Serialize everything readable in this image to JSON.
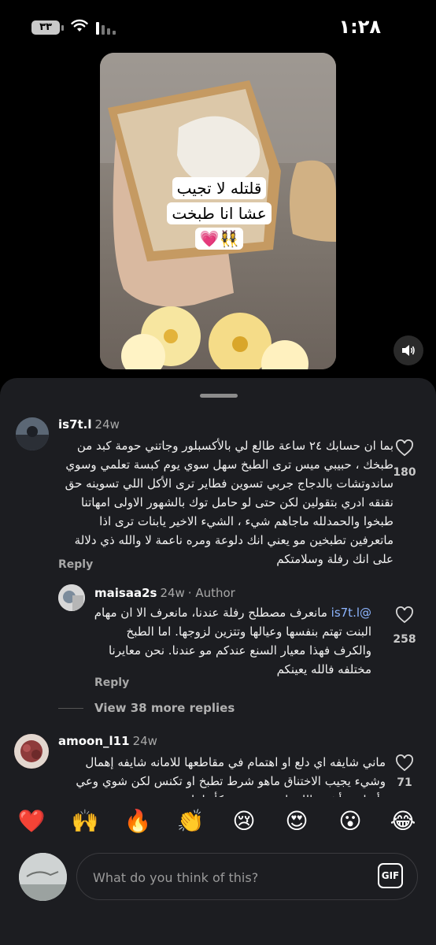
{
  "status_bar": {
    "time": "١:٢٨",
    "battery": "٣٣"
  },
  "video": {
    "caption": "قلتله لا تجيب عشا انا طبخت👯‍♀️💗"
  },
  "comments": [
    {
      "username": "is7t.l",
      "age": "24w",
      "text": "بما ان حسابك ٢٤ ساعة طالع لي بالأكسبلور وجاتني حومة كبد من طبخك ، حبيبي ميس ترى الطبخ سهل سوي يوم كبسة تعلمي وسوي ساندوتشات بالدجاج جربي تسوين فطاير ترى الأكل اللي تسوينه حق نقنقه ادري بتقولين لكن حتى لو حامل توك بالشهور الاولى امهاتنا طبخوا والحمدلله ماجاهم شيء ، الشيء الاخير يابنات ترى اذا ماتعرفين تطبخين مو يعني انك دلوعة ومره ناعمة لا والله ذي دلالة على انك رفلة وسلامتكم",
      "reply_label": "Reply",
      "likes": "180"
    },
    {
      "username": "maisaa2s",
      "age": "24w",
      "badge": "· Author",
      "mention": "@is7t.l",
      "text": "مانعرف مصطلح رفلة عندنا، مانعرف الا ان مهام البنت تهتم بنفسها وعيالها وتتزين لزوجها. اما الطبخ والكرف فهذا معيار السنع عندكم مو عندنا. نحن معايرنا مختلفه فالله يعينكم",
      "reply_label": "Reply",
      "likes": "258"
    },
    {
      "username": "amoon_l11",
      "age": "24w",
      "text": "ماني شايفه اي دلع او اهتمام في مقاطعها للامانه شايفه إهمال وشيء يجيب الاختناق ماهو شرط تطبخ او تكنس لكن شوي وعي وأسلوب أنثوي اللي اسمعه وحده كأنها نايمه وهي",
      "likes": "71"
    }
  ],
  "view_more": "View 38 more replies",
  "reactions": [
    "❤️",
    "🙌",
    "🔥",
    "👏",
    "😢",
    "😍",
    "😮",
    "😂"
  ],
  "input": {
    "placeholder": "What do you think of this?",
    "gif_label": "GIF"
  }
}
